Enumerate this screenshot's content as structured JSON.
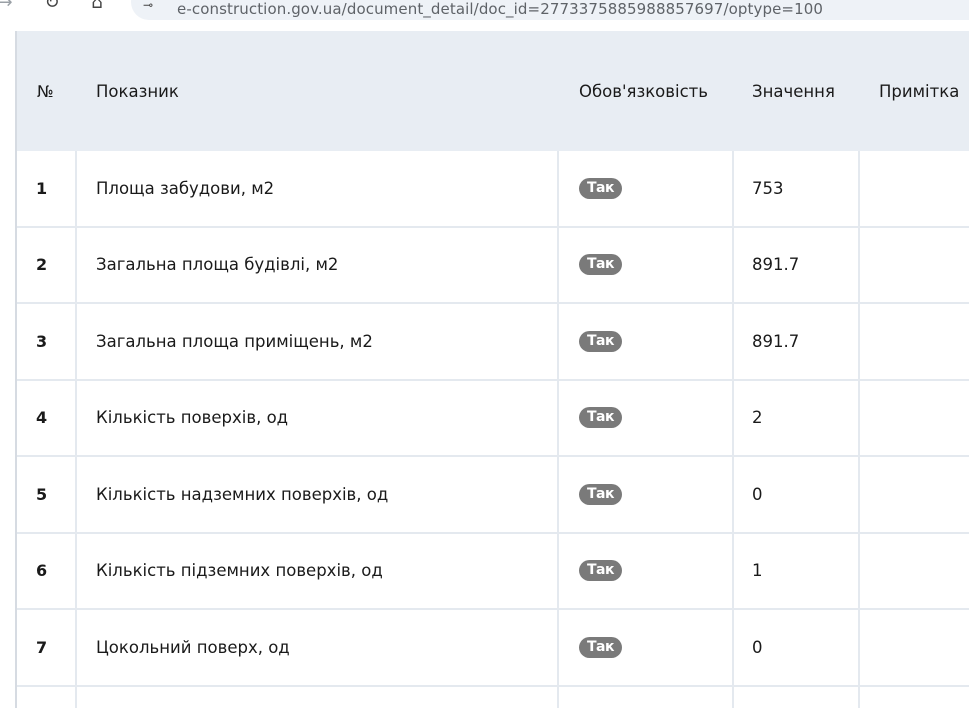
{
  "browser": {
    "url": "e-construction.gov.ua/document_detail/doc_id=2773375885988857697/optype=100",
    "icons": {
      "back": "arrow-left-icon",
      "reload": "reload-icon",
      "home": "home-icon",
      "site_info": "site-settings-icon"
    }
  },
  "table": {
    "headers": {
      "num": "№",
      "indicator": "Показник",
      "mandatory": "Обов'язковість",
      "value": "Значення",
      "note": "Примітка"
    },
    "rows": [
      {
        "num": "1",
        "indicator": "Площа забудови, м2",
        "mandatory": "Так",
        "value": "753",
        "note": ""
      },
      {
        "num": "2",
        "indicator": "Загальна площа будівлі, м2",
        "mandatory": "Так",
        "value": "891.7",
        "note": ""
      },
      {
        "num": "3",
        "indicator": "Загальна площа приміщень, м2",
        "mandatory": "Так",
        "value": "891.7",
        "note": ""
      },
      {
        "num": "4",
        "indicator": "Кількість поверхів, од",
        "mandatory": "Так",
        "value": "2",
        "note": ""
      },
      {
        "num": "5",
        "indicator": "Кількість надземних поверхів, од",
        "mandatory": "Так",
        "value": "0",
        "note": ""
      },
      {
        "num": "6",
        "indicator": "Кількість підземних поверхів, од",
        "mandatory": "Так",
        "value": "1",
        "note": ""
      },
      {
        "num": "7",
        "indicator": "Цокольний поверх, од",
        "mandatory": "Так",
        "value": "0",
        "note": ""
      }
    ]
  },
  "colors": {
    "header_bg": "#e8edf3",
    "badge_bg": "#7a7a7a",
    "grid_line": "#e4e9ef"
  }
}
